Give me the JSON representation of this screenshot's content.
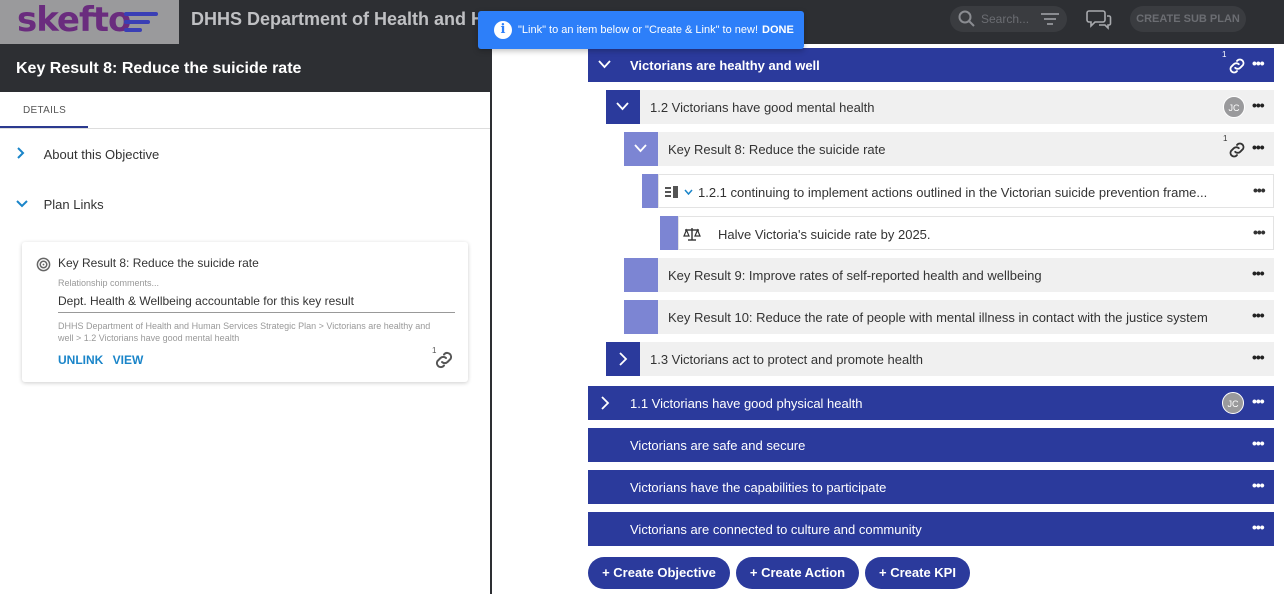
{
  "header": {
    "logo_text": "skefto",
    "app_title": "DHHS Department of Health and Hu",
    "search_placeholder": "Search...",
    "create_sub_plan_label": "CREATE SUB PLAN"
  },
  "toast": {
    "message": "\"Link\" to an item below or \"Create & Link\" to new!",
    "done_label": "DONE"
  },
  "left_panel": {
    "title": "Key Result 8: Reduce the suicide rate",
    "tab_details": "DETAILS",
    "section_about": "About this Objective",
    "section_plan_links": "Plan Links",
    "card": {
      "title": "Key Result 8: Reduce the suicide rate",
      "relationship_label": "Relationship comments...",
      "comment": "Dept. Health & Wellbeing accountable for this key result",
      "path": "DHHS Department of Health and Human Services Strategic Plan > Victorians are healthy and well > 1.2 Victorians have good mental health",
      "unlink_label": "UNLINK",
      "view_label": "VIEW",
      "link_count": "1"
    }
  },
  "tree": {
    "r1": {
      "label": "Victorians are healthy and well",
      "link_count": "1"
    },
    "r2": {
      "label": "1.2 Victorians have good mental health",
      "avatar": "JC"
    },
    "r3": {
      "label": "Key Result 8: Reduce the suicide rate",
      "link_count": "1"
    },
    "r4": {
      "label": "1.2.1 continuing to implement actions outlined in the Victorian suicide prevention frame..."
    },
    "r5": {
      "label": "Halve Victoria's suicide rate by 2025."
    },
    "r6": {
      "label": "Key Result 9: Improve rates of self-reported health and wellbeing"
    },
    "r7": {
      "label": "Key Result 10: Reduce the rate of people with mental illness in contact with the justice system"
    },
    "r8": {
      "label": "1.3 Victorians act to protect and promote health"
    },
    "r9": {
      "label": "1.1 Victorians have good physical health",
      "avatar": "JC"
    },
    "r10": {
      "label": "Victorians are safe and secure"
    },
    "r11": {
      "label": "Victorians have the capabilities to participate"
    },
    "r12": {
      "label": "Victorians are connected to culture and community"
    }
  },
  "buttons": {
    "create_objective": "+ Create Objective",
    "create_action": "+ Create Action",
    "create_kpi": "+ Create KPI"
  },
  "more_glyph": "•••",
  "colors": {
    "primary": "#2b3a9c",
    "toggle_light": "#7c85d3",
    "accent_link": "#1a85c9",
    "topbar": "#2d2f33"
  }
}
